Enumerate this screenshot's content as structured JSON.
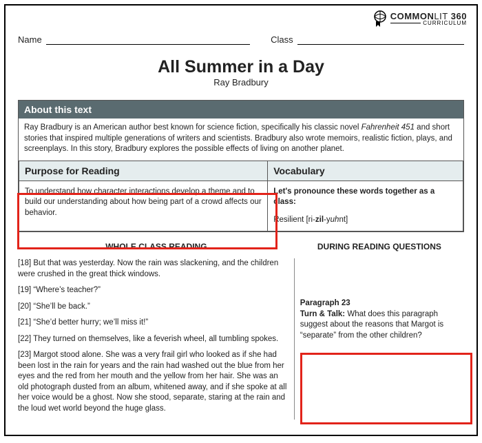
{
  "brand": {
    "name1": "COMMON",
    "name2": "LIT",
    "name3": "360",
    "sub": "CURRICULUM"
  },
  "fields": {
    "name_label": "Name",
    "class_label": "Class"
  },
  "title": "All Summer in a Day",
  "author": "Ray Bradbury",
  "about": {
    "header": "About this text",
    "body_a": "Ray Bradbury is an American author best known for science fiction, specifically his classic novel ",
    "body_em": "Fahrenheit 451",
    "body_b": " and short stories that inspired multiple generations of writers and scientists. Bradbury also wrote memoirs, realistic fiction, plays, and screenplays. In this story, Bradbury explores the possible effects of living on another planet."
  },
  "purpose": {
    "heading": "Purpose for Reading",
    "body": "To understand how character interactions develop a theme and to build our understanding about how being part of a crowd affects our behavior."
  },
  "vocab": {
    "heading": "Vocabulary",
    "lead": "Let's pronounce these words together as a class:",
    "word": "Resilient [ri-",
    "word_b": "zil",
    "word_c": "-y",
    "word_d": "uh",
    "word_e": "nt]"
  },
  "sections": {
    "left": "WHOLE CLASS READING",
    "right": "DURING READING QUESTIONS"
  },
  "passage": {
    "p18": "[18] But that was yesterday. Now the rain was slackening, and the children were crushed in the great thick windows.",
    "p19": "[19] “Where’s teacher?”",
    "p20": "[20] “She’ll be back.”",
    "p21": "[21] “She’d better hurry; we’ll miss it!”",
    "p22": "[22] They turned on themselves, like a feverish wheel, all tumbling spokes.",
    "p23": "[23] Margot stood alone. She was a very frail girl who looked as if she had been lost in the rain for years and the rain had washed out the blue from her eyes and the red from her mouth and the yellow from her hair. She was an old photograph dusted from an album, whitened away, and if she spoke at all her voice would be a ghost. Now she stood, separate, staring at the rain and the loud wet world beyond the huge glass."
  },
  "question": {
    "title": "Paragraph 23",
    "lead": "Turn & Talk:",
    "body": " What does this paragraph suggest about the reasons that Margot is “separate” from the other children?"
  }
}
